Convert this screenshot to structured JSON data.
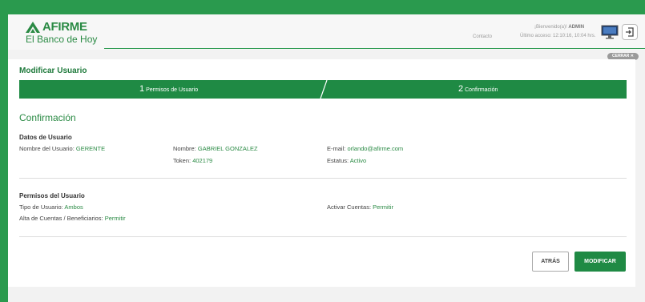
{
  "brand": {
    "name": "AFIRME",
    "tagline": "El Banco de Hoy",
    "color": "#2a8a44"
  },
  "header": {
    "contact": "Contacto",
    "welcome_prefix": "¡Bienvenido(a)!",
    "user": "ADMIN",
    "last_access": "Último acceso: 12:10:16, 10:04 hrs.",
    "close_label": "CERRAR"
  },
  "page": {
    "title": "Modificar Usuario",
    "section_title": "Confirmación"
  },
  "steps": [
    {
      "num": "1",
      "label": "Permisos de Usuario"
    },
    {
      "num": "2",
      "label": "Confirmación"
    }
  ],
  "user_data": {
    "heading": "Datos de Usuario",
    "username_label": "Nombre del Usuario:",
    "username": "GERENTE",
    "name_label": "Nombre:",
    "name": "GABRIEL GONZALEZ",
    "token_label": "Token:",
    "token": "402179",
    "email_label": "E-mail:",
    "email": "orlando@afirme.com",
    "status_label": "Estatus:",
    "status": "Activo"
  },
  "permissions": {
    "heading": "Permisos del Usuario",
    "user_type_label": "Tipo de Usuario:",
    "user_type": "Ambos",
    "activate_label": "Activar Cuentas:",
    "activate": "Permitir",
    "accounts_label": "Alta de Cuentas / Beneficiarios:",
    "accounts": "Permitir"
  },
  "actions": {
    "back": "ATRÁS",
    "modify": "MODIFICAR"
  }
}
